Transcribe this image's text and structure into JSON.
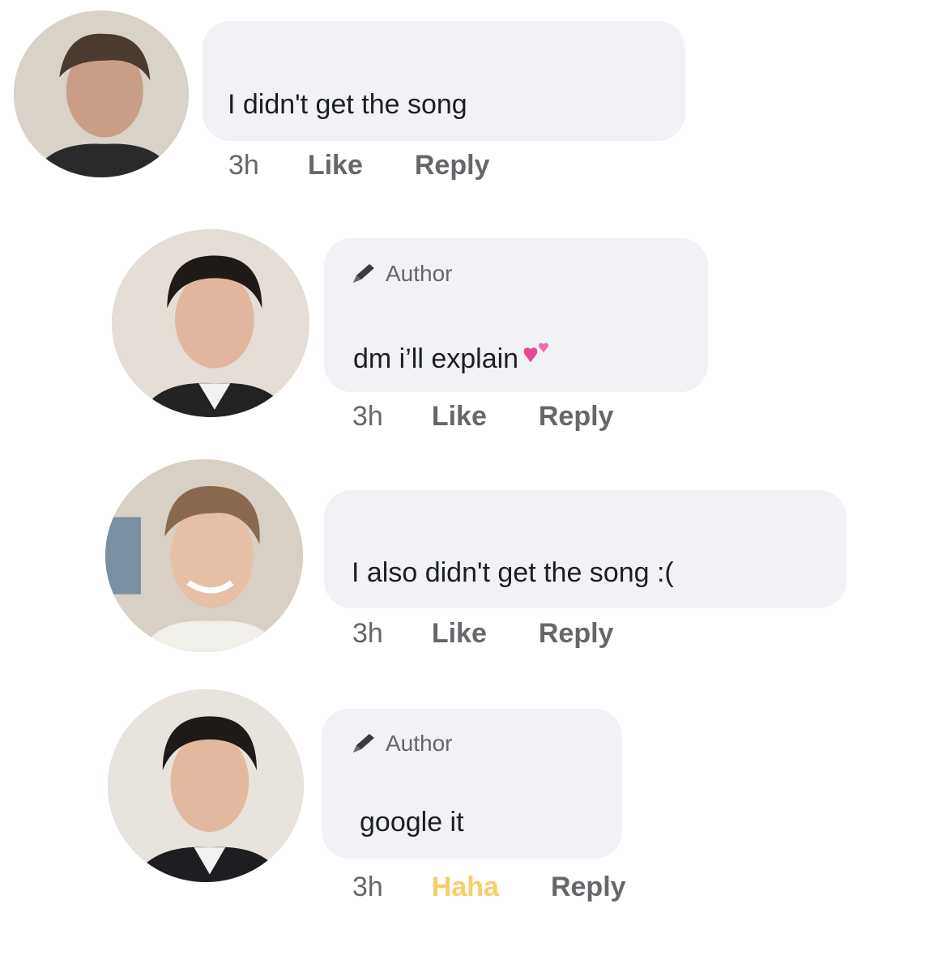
{
  "comments": [
    {
      "author_tag": "",
      "text": "I didn't get the song",
      "time": "3h",
      "reaction_label": "Like",
      "reply_label": "Reply"
    },
    {
      "author_tag": "Author",
      "text": "dm i’ll explain",
      "time": "3h",
      "reaction_label": "Like",
      "reply_label": "Reply"
    },
    {
      "author_tag": "",
      "text": "I also didn't get the song :(",
      "time": "3h",
      "reaction_label": "Like",
      "reply_label": "Reply"
    },
    {
      "author_tag": "Author",
      "text": "google it",
      "time": "3h",
      "reaction_label": "Haha",
      "reply_label": "Reply"
    }
  ],
  "icons": {
    "author_badge": "pencil-icon",
    "emoji": "two-hearts-icon"
  },
  "colors": {
    "bubble": "#f0f2f5",
    "meta_text": "#65676b",
    "haha_reaction": "#f7b928",
    "heart_pink": "#e8489a"
  }
}
